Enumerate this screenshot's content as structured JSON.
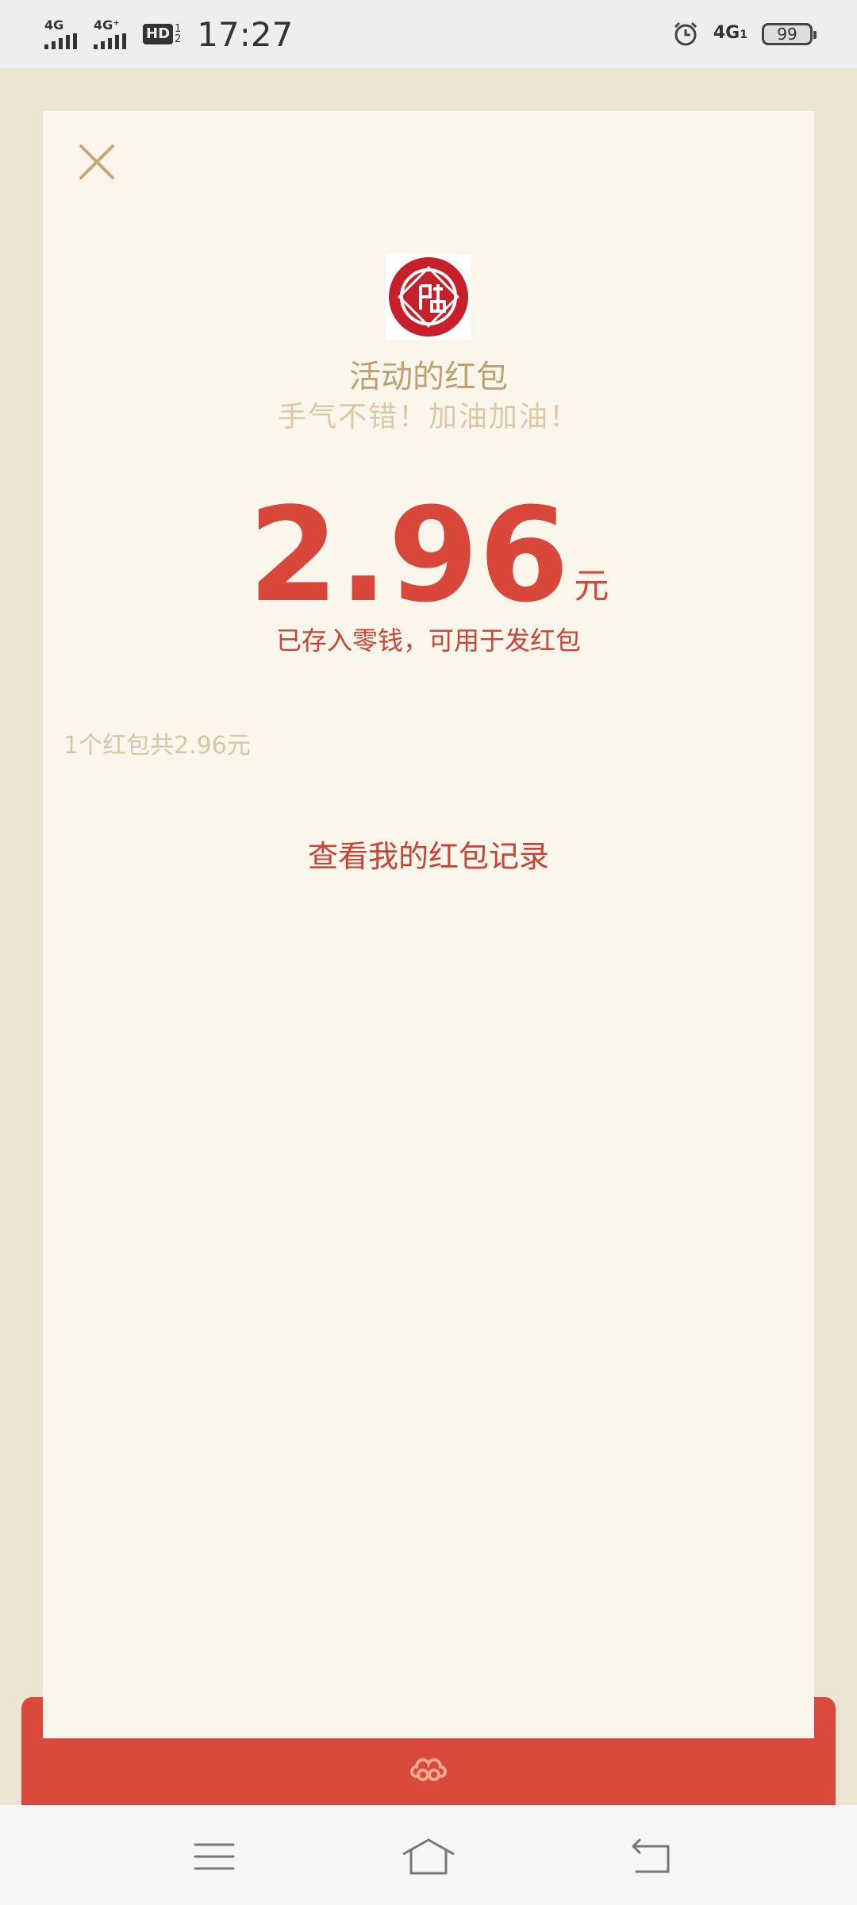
{
  "status_bar": {
    "time": "17:27",
    "sim1_label": "4G",
    "sim2_label": "4G⁺",
    "hd_label": "HD",
    "hd_sub_top": "1",
    "hd_sub_bottom": "2",
    "net_label": "4G",
    "net_sub": "1",
    "battery": "99"
  },
  "packet": {
    "title": "活动的红包",
    "subtitle": "手气不错！加油加油！",
    "amount": "2.96",
    "unit": "元",
    "stored_note": "已存入零钱，可用于发红包",
    "summary": "1个红包共2.96元",
    "records_link": "查看我的红包记录"
  },
  "colors": {
    "accent_red": "#D9473A",
    "gold": "#BFA070",
    "card_bg": "#FAF6EB",
    "page_bg": "#EDE5D3"
  },
  "icons": {
    "close": "close-icon",
    "logo": "seal-logo-icon",
    "cloud": "cloud-ornament-icon",
    "menu": "menu-icon",
    "home": "home-icon",
    "back": "back-icon",
    "alarm": "alarm-icon"
  }
}
